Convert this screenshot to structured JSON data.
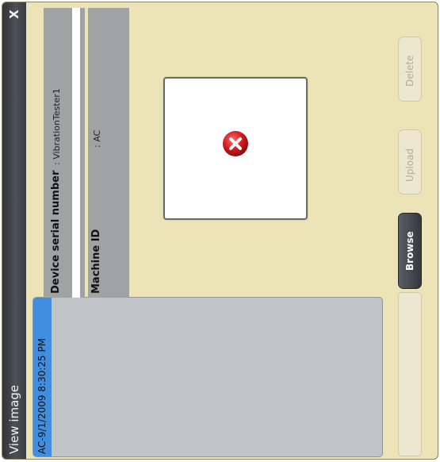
{
  "window": {
    "title": "View image",
    "close_label": "X"
  },
  "image_list": {
    "items": [
      {
        "label": "AC-9/1/2009 8:30:25 PM",
        "selected": true
      }
    ]
  },
  "device_info": {
    "serial_label": "Device serial number",
    "serial_value": ": VibrationTester1",
    "machine_label": "Machine ID",
    "machine_value": ": AC"
  },
  "preview": {
    "icon": "error-x-icon",
    "icon_color": "#d0191c"
  },
  "buttons": {
    "browse": "Browse",
    "upload": "Upload",
    "delete": "Delete"
  },
  "colors": {
    "background": "#ece3b6",
    "titlebar": "#3a3e43",
    "selection": "#3f8ee0"
  }
}
